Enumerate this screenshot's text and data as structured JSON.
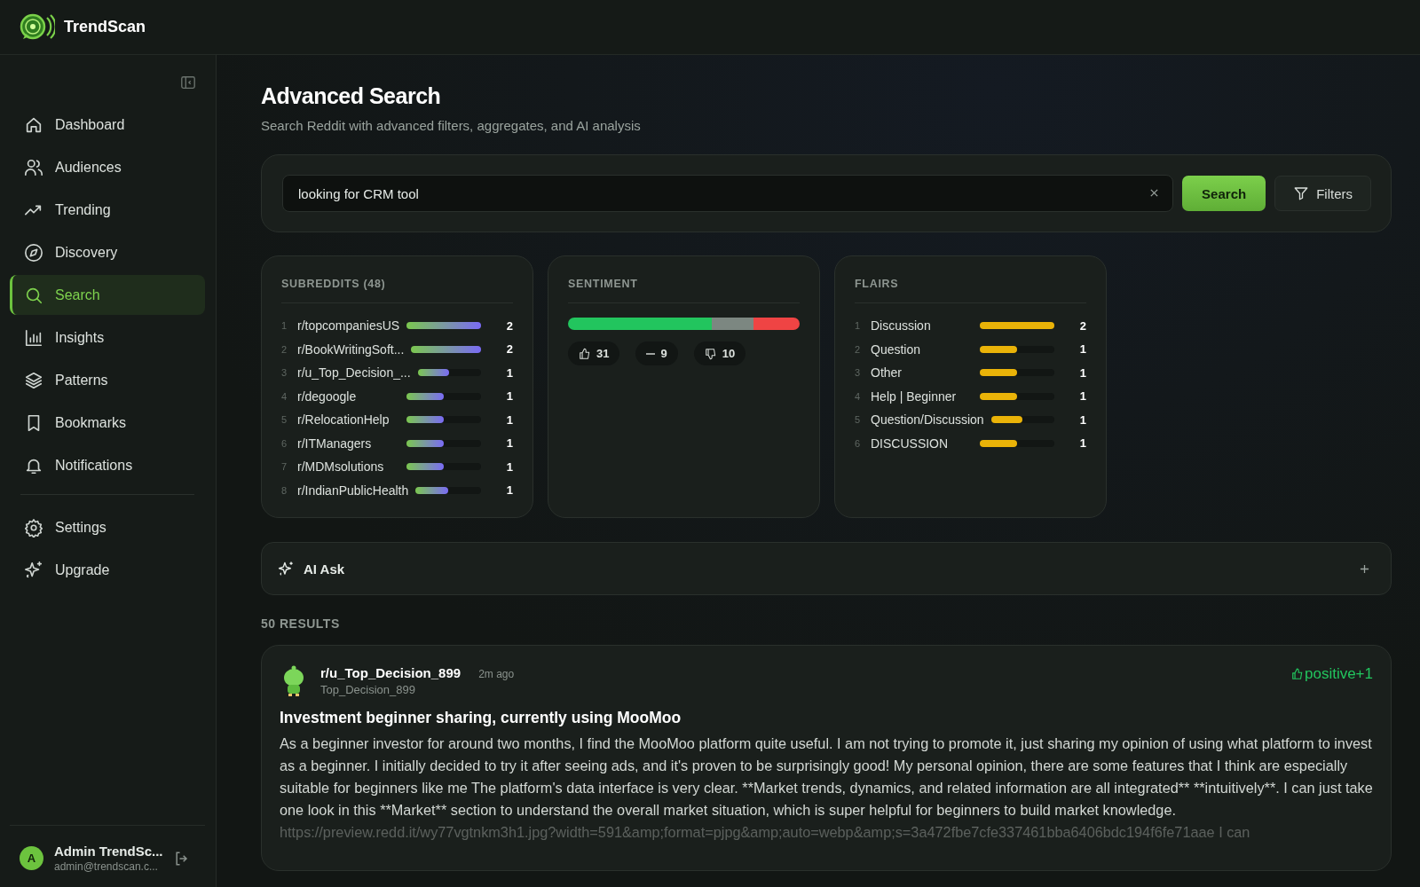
{
  "app": {
    "name": "TrendScan"
  },
  "sidebar": {
    "items": [
      {
        "label": "Dashboard",
        "selected": false
      },
      {
        "label": "Audiences",
        "selected": false
      },
      {
        "label": "Trending",
        "selected": false
      },
      {
        "label": "Discovery",
        "selected": false
      },
      {
        "label": "Search",
        "selected": true
      },
      {
        "label": "Insights",
        "selected": false
      },
      {
        "label": "Patterns",
        "selected": false
      },
      {
        "label": "Bookmarks",
        "selected": false
      },
      {
        "label": "Notifications",
        "selected": false
      }
    ],
    "bottom_items": [
      {
        "label": "Settings",
        "selected": false
      },
      {
        "label": "Upgrade",
        "selected": false
      }
    ],
    "user": {
      "initial": "A",
      "name": "Admin TrendSc...",
      "email": "admin@trendscan.c..."
    }
  },
  "page": {
    "title": "Advanced Search",
    "subtitle": "Search Reddit with advanced filters, aggregates, and AI analysis"
  },
  "search": {
    "value": "looking for CRM tool",
    "button": "Search",
    "filters_button": "Filters"
  },
  "subreddits": {
    "title": "SUBREDDITS (48)",
    "rows": [
      {
        "rank": "1",
        "name": "r/topcompaniesUS",
        "level": 1,
        "count": "2"
      },
      {
        "rank": "2",
        "name": "r/BookWritingSoft...",
        "level": 1,
        "count": "2"
      },
      {
        "rank": "3",
        "name": "r/u_Top_Decision_...",
        "level": 0.5,
        "count": "1"
      },
      {
        "rank": "4",
        "name": "r/degoogle",
        "level": 0.5,
        "count": "1"
      },
      {
        "rank": "5",
        "name": "r/RelocationHelp",
        "level": 0.5,
        "count": "1"
      },
      {
        "rank": "6",
        "name": "r/ITManagers",
        "level": 0.5,
        "count": "1"
      },
      {
        "rank": "7",
        "name": "r/MDMsolutions",
        "level": 0.5,
        "count": "1"
      },
      {
        "rank": "8",
        "name": "r/IndianPublicHealth",
        "level": 0.5,
        "count": "1"
      }
    ]
  },
  "sentiment": {
    "title": "SENTIMENT",
    "segments": [
      {
        "color": "#22c55e"
      },
      {
        "color": "#7c8781"
      },
      {
        "color": "#ef4444"
      }
    ],
    "chips": [
      {
        "kind": "positive",
        "count": "31"
      },
      {
        "kind": "neutral",
        "count": "9"
      },
      {
        "kind": "negative",
        "count": "10"
      }
    ]
  },
  "flairs": {
    "title": "FLAIRS",
    "rows": [
      {
        "rank": "1",
        "name": "Discussion",
        "level": 1,
        "count": "2"
      },
      {
        "rank": "2",
        "name": "Question",
        "level": 0.5,
        "count": "1"
      },
      {
        "rank": "3",
        "name": "Other",
        "level": 0.5,
        "count": "1"
      },
      {
        "rank": "4",
        "name": "Help | Beginner",
        "level": 0.5,
        "count": "1"
      },
      {
        "rank": "5",
        "name": "Question/Discussion",
        "level": 0.5,
        "count": "1"
      },
      {
        "rank": "6",
        "name": "DISCUSSION",
        "level": 0.5,
        "count": "1"
      }
    ]
  },
  "ai_ask": {
    "label": "AI Ask",
    "expanded": false
  },
  "results": {
    "count_label": "50 RESULTS",
    "posts": [
      {
        "subreddit": "r/u_Top_Decision_899",
        "time": "2m ago",
        "author": "Top_Decision_899",
        "sentiment_label": "positive+1",
        "title": "Investment beginner sharing, currently using MooMoo",
        "body": "As a beginner investor for around two months, I find the MooMoo platform quite useful. I am not trying to promote it, just sharing my opinion of using what platform to invest as a beginner. I initially decided to try it after seeing ads, and it's proven to be surprisingly good! My personal opinion, there are some features that I think are especially suitable for beginners like me The platform's data interface is very clear. **Market trends, dynamics, and related information are all integrated** **intuitively**. I can just take one look in this **Market** section to understand the overall market situation, which is super helpful for beginners to build market knowledge. https://preview.redd.it/wy77vgtnkm3h1.jpg?width=591&amp;format=pjpg&amp;auto=webp&amp;s=3a472fbe7cfe337461bba6406bdc194f6fe71aae I can"
      }
    ]
  }
}
